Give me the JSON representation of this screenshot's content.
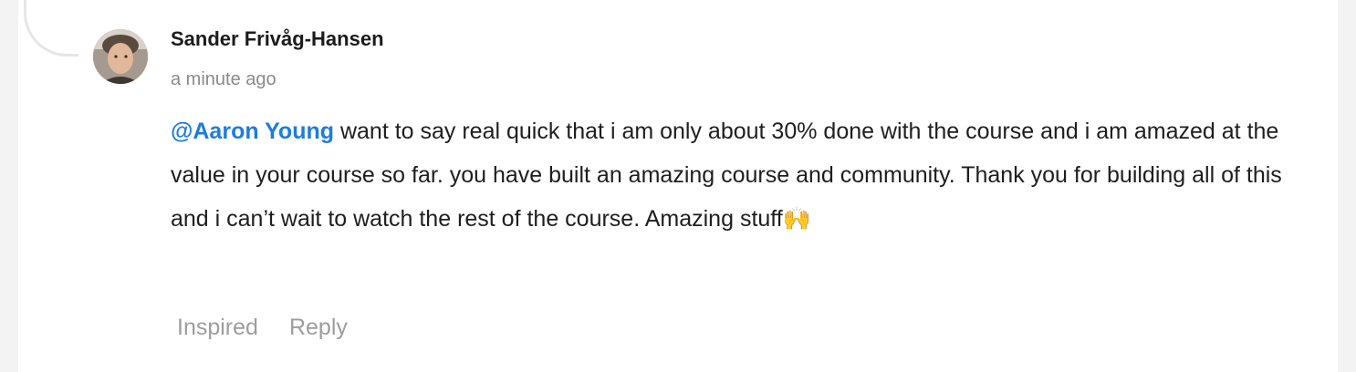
{
  "comment": {
    "author": "Sander Frivåg-Hansen",
    "timestamp": "a minute ago",
    "mention": "@Aaron Young",
    "text": " want to say real quick that i am only about 30% done with the course and i am amazed at the value in your course so far. you have built an amazing course and community. Thank you for building all of this and i can’t wait to watch the rest of the course. Amazing stuff",
    "emoji": "🙌"
  },
  "actions": {
    "inspired_label": "Inspired",
    "reply_label": "Reply"
  }
}
